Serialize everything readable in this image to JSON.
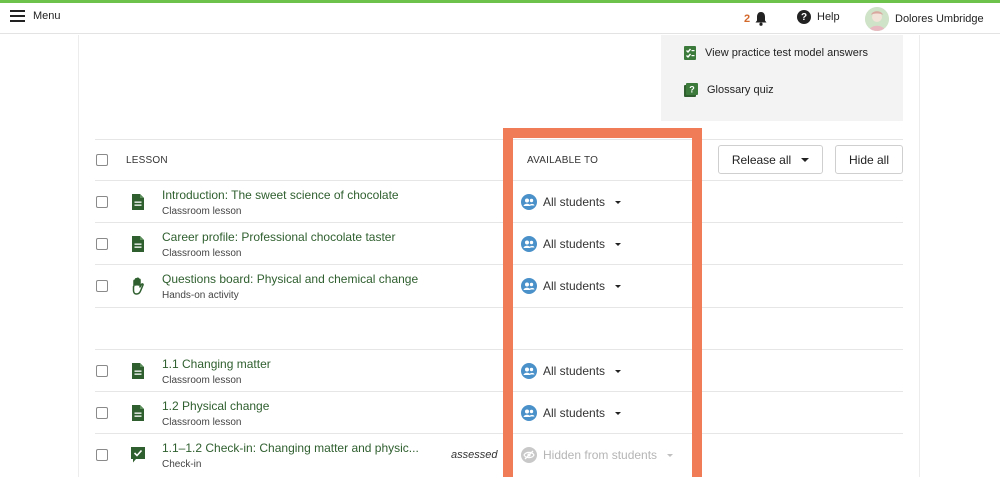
{
  "topbar": {
    "menu_label": "Menu",
    "notification_count": "2",
    "help_label": "Help",
    "user_name": "Dolores Umbridge"
  },
  "panel": {
    "items": [
      {
        "label": "View practice test model answers",
        "icon": "answers-icon"
      },
      {
        "label": "Glossary quiz",
        "icon": "quiz-icon"
      }
    ]
  },
  "table": {
    "col_lesson": "LESSON",
    "col_available": "AVAILABLE TO",
    "release_all_label": "Release all",
    "hide_all_label": "Hide all",
    "rows": [
      {
        "title": "Introduction: The sweet science of chocolate",
        "type": "Classroom lesson",
        "icon": "document-icon",
        "available": "All students"
      },
      {
        "title": "Career profile: Professional chocolate taster",
        "type": "Classroom lesson",
        "icon": "document-icon",
        "available": "All students"
      },
      {
        "title": "Questions board: Physical and chemical change",
        "type": "Hands-on activity",
        "icon": "hand-icon",
        "available": "All students"
      },
      {
        "title": "1.1 Changing matter",
        "type": "Classroom lesson",
        "icon": "document-icon",
        "available": "All students"
      },
      {
        "title": "1.2 Physical change",
        "type": "Classroom lesson",
        "icon": "document-icon",
        "available": "All students"
      },
      {
        "title": "1.1–1.2 Check-in: Changing matter and physic...",
        "type": "Check-in",
        "icon": "checkin-icon",
        "assessed": "assessed",
        "available": "Hidden from students"
      }
    ]
  },
  "colors": {
    "accent_green": "#2f5f2f",
    "highlight": "#ef7b57",
    "available_icon": "#4a90c9"
  }
}
